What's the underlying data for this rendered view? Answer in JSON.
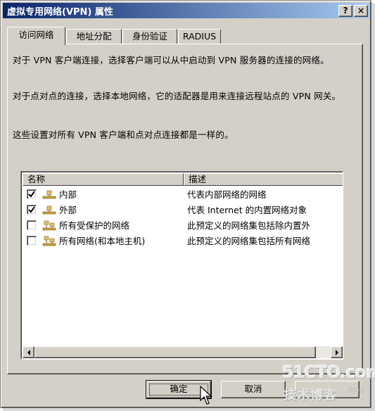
{
  "window": {
    "title": "虚拟专用网络(VPN) 属性",
    "help_label": "?",
    "close_label": "×"
  },
  "tabs": [
    {
      "label": "访问网络",
      "active": true
    },
    {
      "label": "地址分配",
      "active": false
    },
    {
      "label": "身份验证",
      "active": false
    },
    {
      "label": "RADIUS",
      "active": false
    }
  ],
  "content": {
    "para1": "对于 VPN 客户端连接，选择客户端可以从中启动到 VPN 服务器的连接的网络。",
    "para2": "对于点对点的连接，选择本地网络，它的适配器是用来连接远程站点的 VPN 网关。",
    "para3": "这些设置对所有 VPN 客户端和点对点连接都是一样的。"
  },
  "networks": {
    "columns": [
      "名称",
      "描述"
    ],
    "rows": [
      {
        "name": "内部",
        "description": "代表内部网络的网络",
        "checked": true
      },
      {
        "name": "外部",
        "description": "代表 Internet 的内置网络对象",
        "checked": true
      },
      {
        "name": "所有受保护的网络",
        "description": "此预定义的网络集包括除内置外",
        "checked": false
      },
      {
        "name": "所有网络(和本地主机)",
        "description": "此预定义的网络集包括所有网络",
        "checked": false
      }
    ]
  },
  "buttons": {
    "ok": "确定",
    "cancel": "取消",
    "apply": ""
  },
  "watermark": {
    "main": "51CTO.com",
    "sub": "技术博客",
    "blog": "Blog"
  }
}
